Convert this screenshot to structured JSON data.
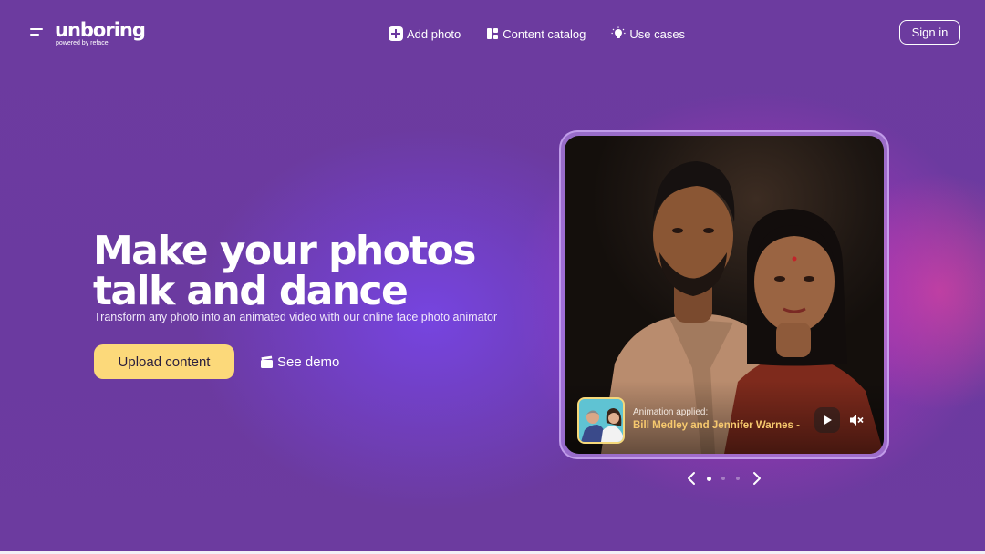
{
  "header": {
    "logo": {
      "word": "unboring",
      "sub": "powered by reface"
    },
    "nav": [
      {
        "label": "Add photo",
        "icon": "plus-square-icon"
      },
      {
        "label": "Content catalog",
        "icon": "catalog-icon"
      },
      {
        "label": "Use cases",
        "icon": "lightbulb-icon"
      }
    ],
    "signin_label": "Sign in"
  },
  "hero": {
    "title_line1": "Make your photos",
    "title_line2": "talk and dance",
    "subtitle": "Transform any photo into an animated video with our online face photo animator",
    "upload_label": "Upload content",
    "demo_label": "See demo"
  },
  "media": {
    "animation_label": "Animation applied:",
    "animation_name": "Bill Medley and Jennifer Warnes -"
  },
  "carousel": {
    "slides": 3,
    "active": 1
  },
  "colors": {
    "background": "#6b3aa0",
    "upload_button": "#fcd97a",
    "accent_name": "#f7c96e"
  }
}
